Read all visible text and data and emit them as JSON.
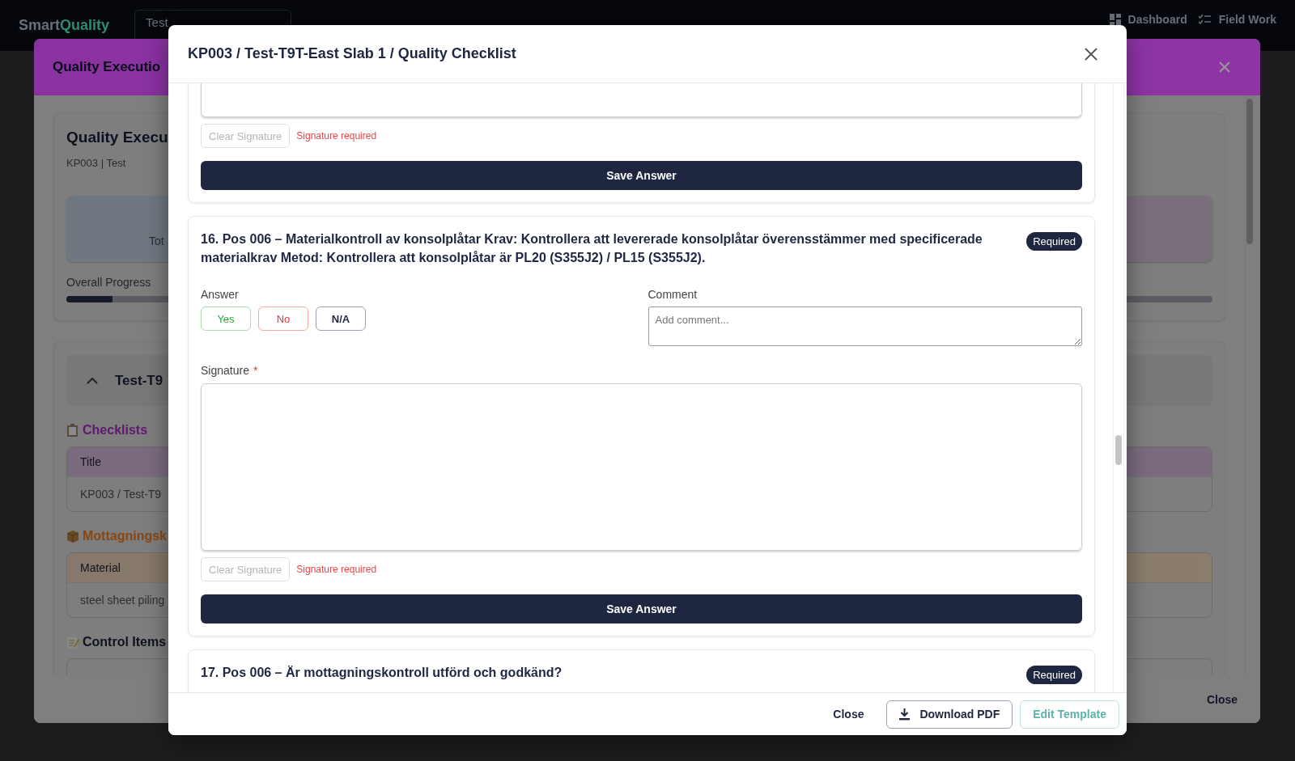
{
  "top_nav": {
    "logo": {
      "part_1": "Smart",
      "part_2": "Quality"
    },
    "project_select": {
      "value": "Test"
    },
    "links": [
      {
        "label": "Dashboard"
      },
      {
        "label": "Field Work"
      }
    ]
  },
  "background_window": {
    "title": "Quality Executio",
    "summary_card": {
      "title": "Quality Execu",
      "subtitle": "KP003 | Test",
      "stat_label": "Tot",
      "progress_label": "Overall Progress",
      "progress": {
        "level": 0.04
      }
    },
    "section": {
      "title": "Test-T9",
      "expanded": true,
      "groups": [
        {
          "kind": "checklists",
          "heading": "Checklists",
          "color": "#5e1a6c",
          "columns": [
            "Title"
          ],
          "rows": [
            [
              "KP003 / Test-T9"
            ]
          ]
        },
        {
          "kind": "materials",
          "heading": "Mottagningsk",
          "color": "#8a4612",
          "columns": [
            "Material"
          ],
          "rows": [
            [
              "steel sheet piling"
            ]
          ]
        },
        {
          "kind": "control_items",
          "heading": "Control Items",
          "color": "#0e1220"
        }
      ]
    },
    "footer_button": "Close"
  },
  "dialog": {
    "title": "KP003 / Test-T9T-East Slab 1 / Quality Checklist",
    "questions": [
      {
        "clear_button": {
          "label": "Clear Signature",
          "disabled": true
        },
        "error": "Signature required",
        "save_button": "Save Answer"
      },
      {
        "title": "16. Pos 006 – Materialkontroll av konsolplåtar Krav: Kontrollera att levererade konsolplåtar överensstämmer med specificerade materialkrav Metod: Kontrollera att konsolplåtar är PL20 (S355J2) / PL15 (S355J2).",
        "badge": "Required",
        "answer_label": "Answer",
        "answers": [
          {
            "label": "Yes",
            "kind": "yes",
            "selected": false
          },
          {
            "label": "No",
            "kind": "no",
            "selected": false
          },
          {
            "label": "N/A",
            "kind": "na",
            "selected": false
          }
        ],
        "comment": {
          "label": "Comment",
          "placeholder": "Add comment..."
        },
        "signature_label": "Signature",
        "required_mark": "*",
        "clear_button": {
          "label": "Clear Signature",
          "disabled": true
        },
        "error": "Signature required",
        "save_button": "Save Answer"
      },
      {
        "title": "17. Pos 006 – Är mottagningskontroll utförd och godkänd?",
        "badge": "Required"
      }
    ],
    "footer": {
      "close": "Close",
      "download": "Download PDF",
      "edit": "Edit Template"
    }
  }
}
